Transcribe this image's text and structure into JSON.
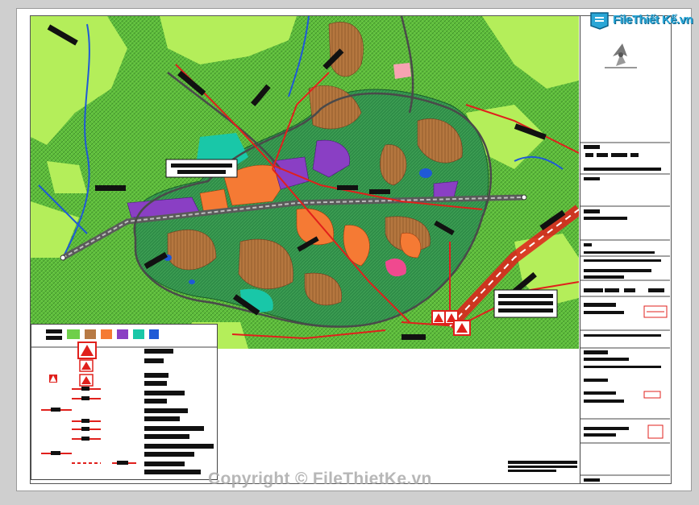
{
  "watermark": {
    "logo_text": "FileThiết Kế.vn",
    "copyright_text": "Copyright © FileThietKe.vn"
  },
  "colors": {
    "map_green": "#6fcf4a",
    "light_green": "#b4ee5a",
    "urban_green": "#2e8c47",
    "residential_brown": "#b77a45",
    "commercial_orange": "#f57a34",
    "industrial_purple": "#8a3fc4",
    "water_blue": "#1f5ad6",
    "teal": "#19c7a8",
    "road_red": "#e0201c",
    "railway_grey": "#6d6d6d",
    "logo_blue": "#2aa6d6"
  },
  "icons": [
    "compass-icon",
    "toll-station-icon",
    "warning-triangle-icon"
  ]
}
